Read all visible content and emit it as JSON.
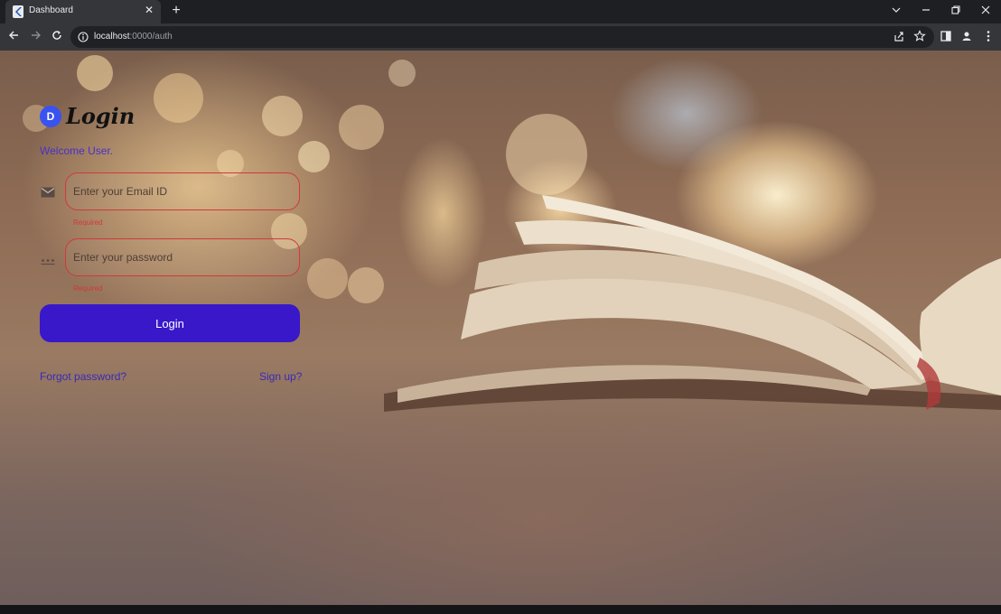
{
  "browser": {
    "tab": {
      "title": "Dashboard",
      "favicon": "flutter-icon",
      "close_icon": "close-icon"
    },
    "new_tab_icon": "plus-icon",
    "window_controls": [
      "chevron-down-icon",
      "minimize-icon",
      "restore-icon",
      "close-icon"
    ],
    "toolbar": {
      "back_icon": "back-arrow-icon",
      "forward_icon": "forward-arrow-icon",
      "reload_icon": "reload-icon",
      "url_host": "localhost",
      "url_path": ":0000/auth",
      "right_icons": [
        "share-icon",
        "bookmark-star-icon",
        "side-panel-icon",
        "profile-icon",
        "kebab-menu-icon"
      ]
    }
  },
  "login": {
    "brand_letter": "D",
    "title": "Login",
    "welcome": "Welcome User.",
    "email": {
      "placeholder": "Enter your Email ID",
      "value": "",
      "error": "Required",
      "icon": "mail-icon"
    },
    "password": {
      "placeholder": "Enter your password",
      "value": "",
      "error": "Required",
      "icon": "password-dots-icon"
    },
    "login_button": "Login",
    "forgot_link": "Forgot password?",
    "signup_link": "Sign up?"
  },
  "colors": {
    "accent": "#3818c9",
    "link": "#3a2ab4",
    "error": "#d2383a",
    "brand_logo": "#3a52f0",
    "chrome_dark": "#1e1f22",
    "chrome_toolbar": "#35363a"
  }
}
